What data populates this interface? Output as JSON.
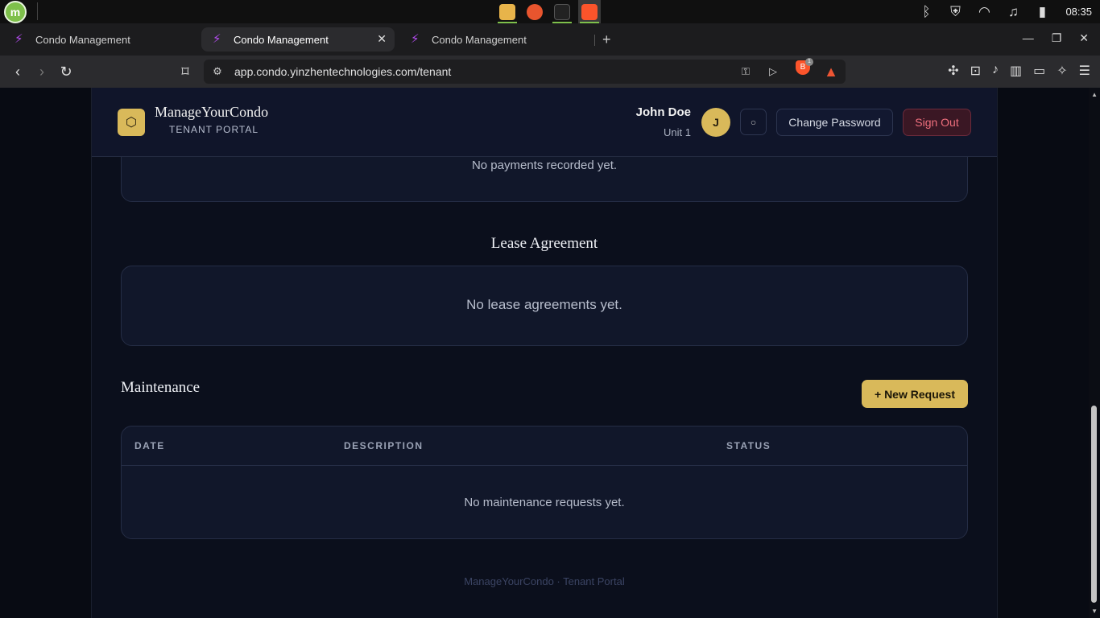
{
  "os": {
    "clock": "08:35"
  },
  "browser": {
    "tabs": [
      {
        "label": "Condo Management"
      },
      {
        "label": "Condo Management"
      },
      {
        "label": "Condo Management"
      }
    ],
    "url": "app.condo.yinzhentechnologies.com/tenant",
    "shield_count": "1"
  },
  "header": {
    "brand_name": "ManageYourCondo",
    "brand_sub": "TENANT PORTAL",
    "user_name": "John Doe",
    "user_unit": "Unit 1",
    "avatar_initial": "J",
    "change_password": "Change Password",
    "sign_out": "Sign Out"
  },
  "payments": {
    "empty": "No payments recorded yet."
  },
  "lease": {
    "title": "Lease Agreement",
    "empty": "No lease agreements yet."
  },
  "maintenance": {
    "title": "Maintenance",
    "new_request": "+ New Request",
    "columns": [
      "DATE",
      "DESCRIPTION",
      "STATUS"
    ],
    "empty": "No maintenance requests yet."
  },
  "footer": "ManageYourCondo · Tenant Portal",
  "colors": {
    "accent_gold": "#d9b95a",
    "danger": "#ef6f7d",
    "background": "#0b0f1c"
  }
}
